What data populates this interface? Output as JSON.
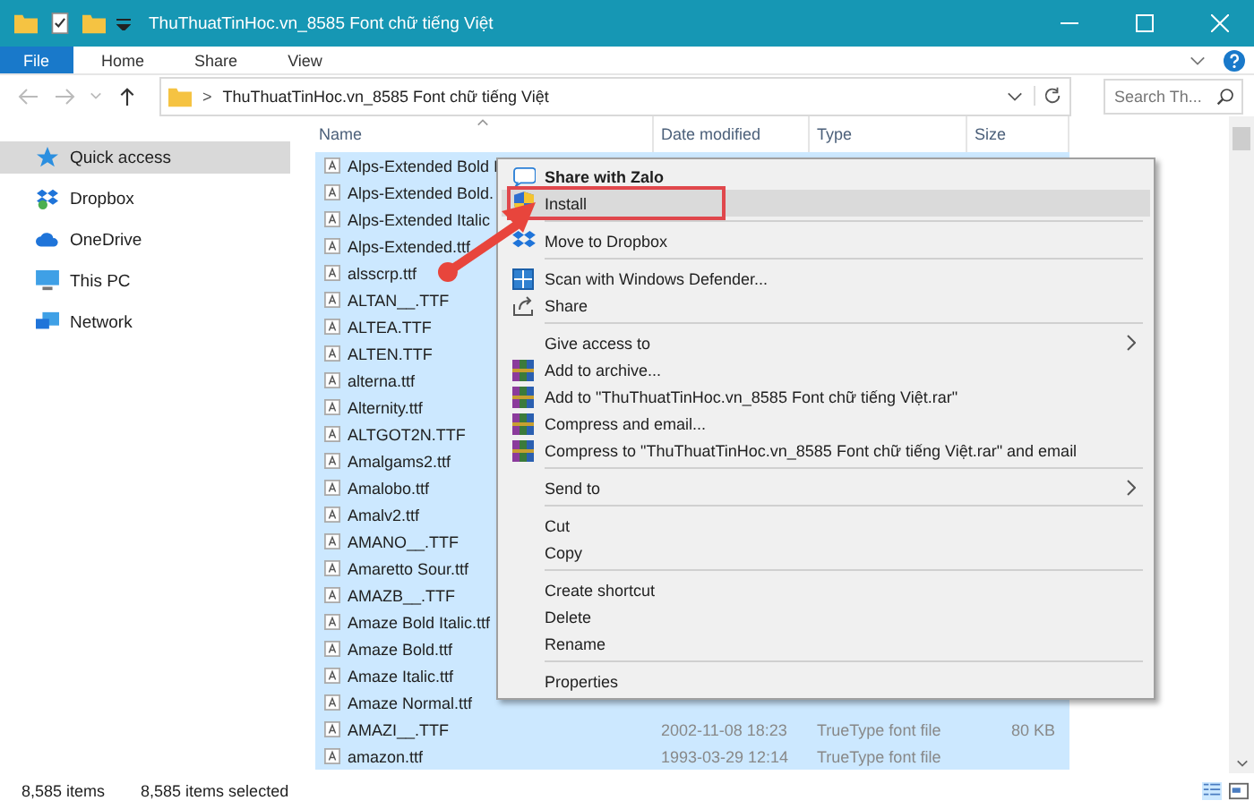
{
  "window": {
    "title": "ThuThuatTinHoc.vn_8585 Font chữ tiếng Việt"
  },
  "ribbon": {
    "tabs": [
      {
        "label": "File",
        "selected": true
      },
      {
        "label": "Home",
        "selected": false
      },
      {
        "label": "Share",
        "selected": false
      },
      {
        "label": "View",
        "selected": false
      }
    ]
  },
  "address_bar": {
    "separator": ">",
    "path": "ThuThuatTinHoc.vn_8585 Font chữ tiếng Việt"
  },
  "search": {
    "placeholder": "Search Th..."
  },
  "sidebar": {
    "items": [
      {
        "label": "Quick access",
        "selected": true
      },
      {
        "label": "Dropbox",
        "selected": false
      },
      {
        "label": "OneDrive",
        "selected": false
      },
      {
        "label": "This PC",
        "selected": false
      },
      {
        "label": "Network",
        "selected": false
      }
    ]
  },
  "table": {
    "columns": [
      "Name",
      "Date modified",
      "Type",
      "Size"
    ],
    "rows": [
      {
        "name": "Alps-Extended Bold I",
        "selected": true
      },
      {
        "name": "Alps-Extended Bold.",
        "selected": true
      },
      {
        "name": "Alps-Extended Italic",
        "selected": true
      },
      {
        "name": "Alps-Extended.ttf",
        "selected": true
      },
      {
        "name": "alsscrp.ttf",
        "selected": true
      },
      {
        "name": "ALTAN__.TTF",
        "selected": true
      },
      {
        "name": "ALTEA.TTF",
        "selected": true
      },
      {
        "name": "ALTEN.TTF",
        "selected": true
      },
      {
        "name": "alterna.ttf",
        "selected": true
      },
      {
        "name": "Alternity.ttf",
        "selected": true
      },
      {
        "name": "ALTGOT2N.TTF",
        "selected": true
      },
      {
        "name": "Amalgams2.ttf",
        "selected": true
      },
      {
        "name": "Amalobo.ttf",
        "selected": true
      },
      {
        "name": "Amalv2.ttf",
        "selected": true
      },
      {
        "name": "AMANO__.TTF",
        "selected": true
      },
      {
        "name": "Amaretto  Sour.ttf",
        "selected": true
      },
      {
        "name": "AMAZB__.TTF",
        "selected": true
      },
      {
        "name": "Amaze Bold Italic.ttf",
        "selected": true
      },
      {
        "name": "Amaze Bold.ttf",
        "selected": true
      },
      {
        "name": "Amaze Italic.ttf",
        "selected": true
      },
      {
        "name": "Amaze Normal.ttf",
        "selected": true
      },
      {
        "name": "AMAZI__.TTF",
        "date": "2002-11-08 18:23",
        "type": "TrueType font file",
        "size": "80 KB",
        "selected": true
      },
      {
        "name": "amazon.ttf",
        "date": "1993-03-29 12:14",
        "type": "TrueType font file",
        "selected": true
      }
    ]
  },
  "context_menu": {
    "groups": [
      [
        {
          "label": "Share with Zalo",
          "bold": true,
          "highlighted": false,
          "submenu": false
        },
        {
          "label": "Install",
          "bold": false,
          "highlighted": true,
          "submenu": false
        }
      ],
      [
        {
          "label": "Move to Dropbox",
          "bold": false,
          "highlighted": false,
          "submenu": false
        }
      ],
      [
        {
          "label": "Scan with Windows Defender...",
          "bold": false,
          "highlighted": false,
          "submenu": false
        },
        {
          "label": "Share",
          "bold": false,
          "highlighted": false,
          "submenu": false
        }
      ],
      [
        {
          "label": "Give access to",
          "bold": false,
          "highlighted": false,
          "submenu": true
        },
        {
          "label": "Add to archive...",
          "bold": false,
          "highlighted": false,
          "submenu": false
        },
        {
          "label": "Add to \"ThuThuatTinHoc.vn_8585 Font chữ tiếng Việt.rar\"",
          "bold": false,
          "highlighted": false,
          "submenu": false
        },
        {
          "label": "Compress and email...",
          "bold": false,
          "highlighted": false,
          "submenu": false
        },
        {
          "label": "Compress to \"ThuThuatTinHoc.vn_8585 Font chữ tiếng Việt.rar\" and email",
          "bold": false,
          "highlighted": false,
          "submenu": false
        }
      ],
      [
        {
          "label": "Send to",
          "bold": false,
          "highlighted": false,
          "submenu": true
        }
      ],
      [
        {
          "label": "Cut",
          "bold": false,
          "highlighted": false,
          "submenu": false
        },
        {
          "label": "Copy",
          "bold": false,
          "highlighted": false,
          "submenu": false
        }
      ],
      [
        {
          "label": "Create shortcut",
          "bold": false,
          "highlighted": false,
          "submenu": false
        },
        {
          "label": "Delete",
          "bold": false,
          "highlighted": false,
          "submenu": false
        },
        {
          "label": "Rename",
          "bold": false,
          "highlighted": false,
          "submenu": false
        }
      ],
      [
        {
          "label": "Properties",
          "bold": false,
          "highlighted": false,
          "submenu": false
        }
      ]
    ]
  },
  "status_bar": {
    "item_count": "8,585 items",
    "selection": "8,585 items selected"
  }
}
